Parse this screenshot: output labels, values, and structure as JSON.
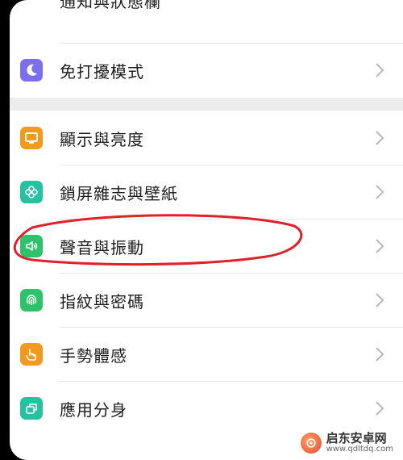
{
  "top_cut_text": "通知與狀態欄",
  "settings": [
    {
      "label": "免打擾模式",
      "icon": "moon-icon",
      "color": "#7b6ff0"
    },
    {
      "label": "顯示與亮度",
      "icon": "monitor-icon",
      "color": "#f39a1e"
    },
    {
      "label": "鎖屏雜志與壁紙",
      "icon": "flower-icon",
      "color": "#25c2a0"
    },
    {
      "label": "聲音與振動",
      "icon": "speaker-icon",
      "color": "#2ec26a"
    },
    {
      "label": "指紋與密碼",
      "icon": "fingerprint-icon",
      "color": "#2ec26a"
    },
    {
      "label": "手勢體感",
      "icon": "hand-icon",
      "color": "#f39a1e"
    },
    {
      "label": "應用分身",
      "icon": "app-clone-icon",
      "color": "#25c2a0"
    }
  ],
  "watermark": {
    "title": "启东安卓网",
    "url": "www.qdltdq.com"
  }
}
